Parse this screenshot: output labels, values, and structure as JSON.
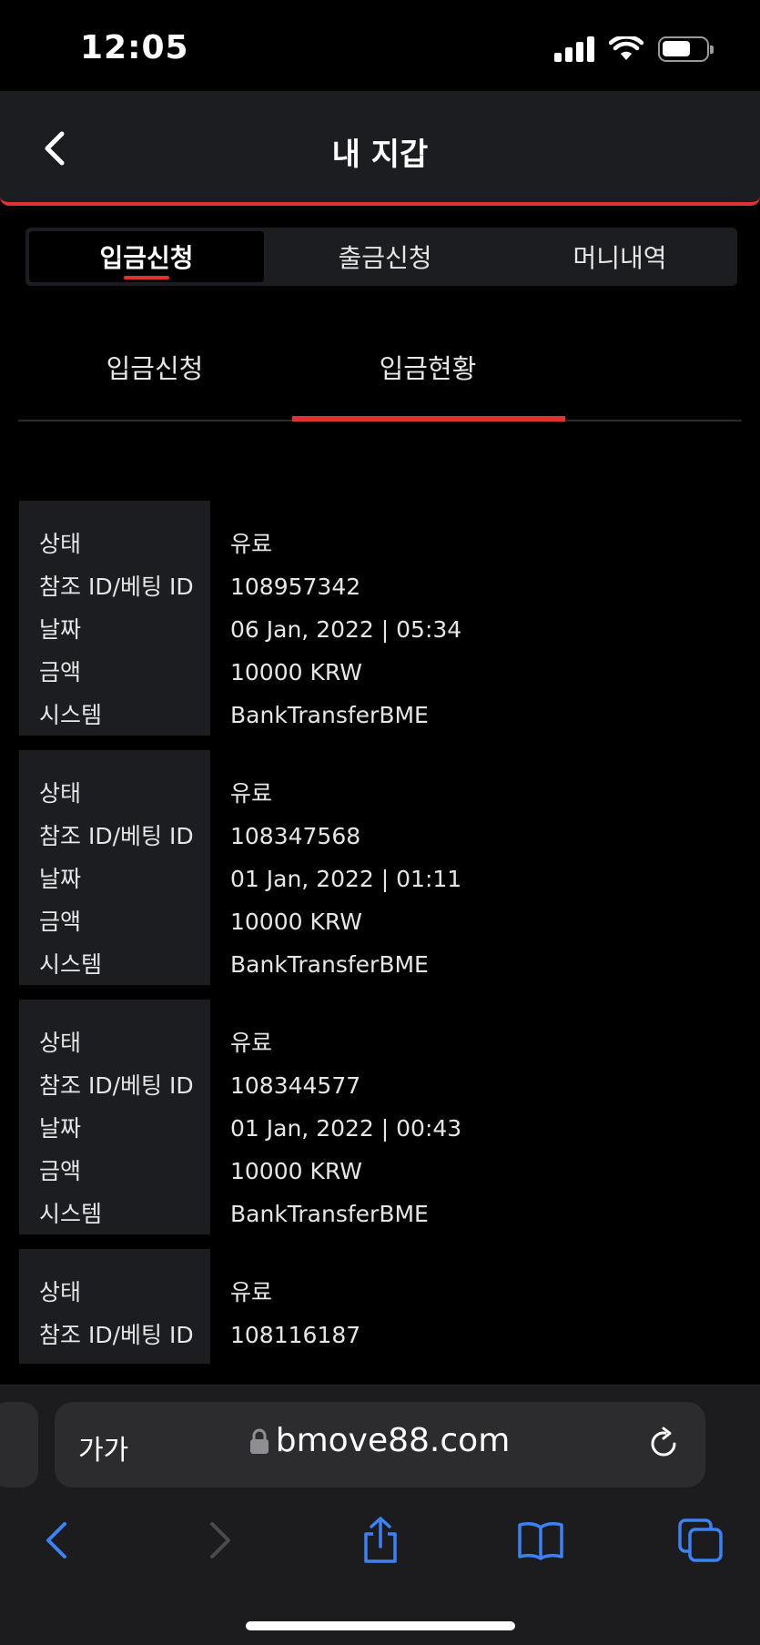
{
  "status": {
    "time": "12:05"
  },
  "header": {
    "title": "내 지갑"
  },
  "segments": [
    {
      "label": "입금신청"
    },
    {
      "label": "출금신청"
    },
    {
      "label": "머니내역"
    }
  ],
  "subtabs": [
    {
      "label": "입금신청"
    },
    {
      "label": "입금현황"
    }
  ],
  "record_labels": {
    "status": "상태",
    "ref_id": "참조 ID/베팅 ID",
    "date": "날짜",
    "amount": "금액",
    "system": "시스템"
  },
  "records": [
    {
      "status": "유료",
      "ref_id": "108957342",
      "date": "06 Jan, 2022 | 05:34",
      "amount": "10000 KRW",
      "system": "BankTransferBME"
    },
    {
      "status": "유료",
      "ref_id": "108347568",
      "date": "01 Jan, 2022 | 01:11",
      "amount": "10000 KRW",
      "system": "BankTransferBME"
    },
    {
      "status": "유료",
      "ref_id": "108344577",
      "date": "01 Jan, 2022 | 00:43",
      "amount": "10000 KRW",
      "system": "BankTransferBME"
    },
    {
      "status": "유료",
      "ref_id": "108116187"
    }
  ],
  "browser": {
    "aa_label": "가가",
    "url": "bmove88.com"
  },
  "icons": {
    "back": "chevron-left-icon",
    "lock": "lock-icon",
    "reload": "reload-icon",
    "share": "share-icon",
    "bookmarks": "book-icon",
    "tabs": "tabs-icon"
  },
  "colors": {
    "accent": "#e1322d",
    "panel": "#1c1d21",
    "browser_blue": "#3b82f6"
  }
}
